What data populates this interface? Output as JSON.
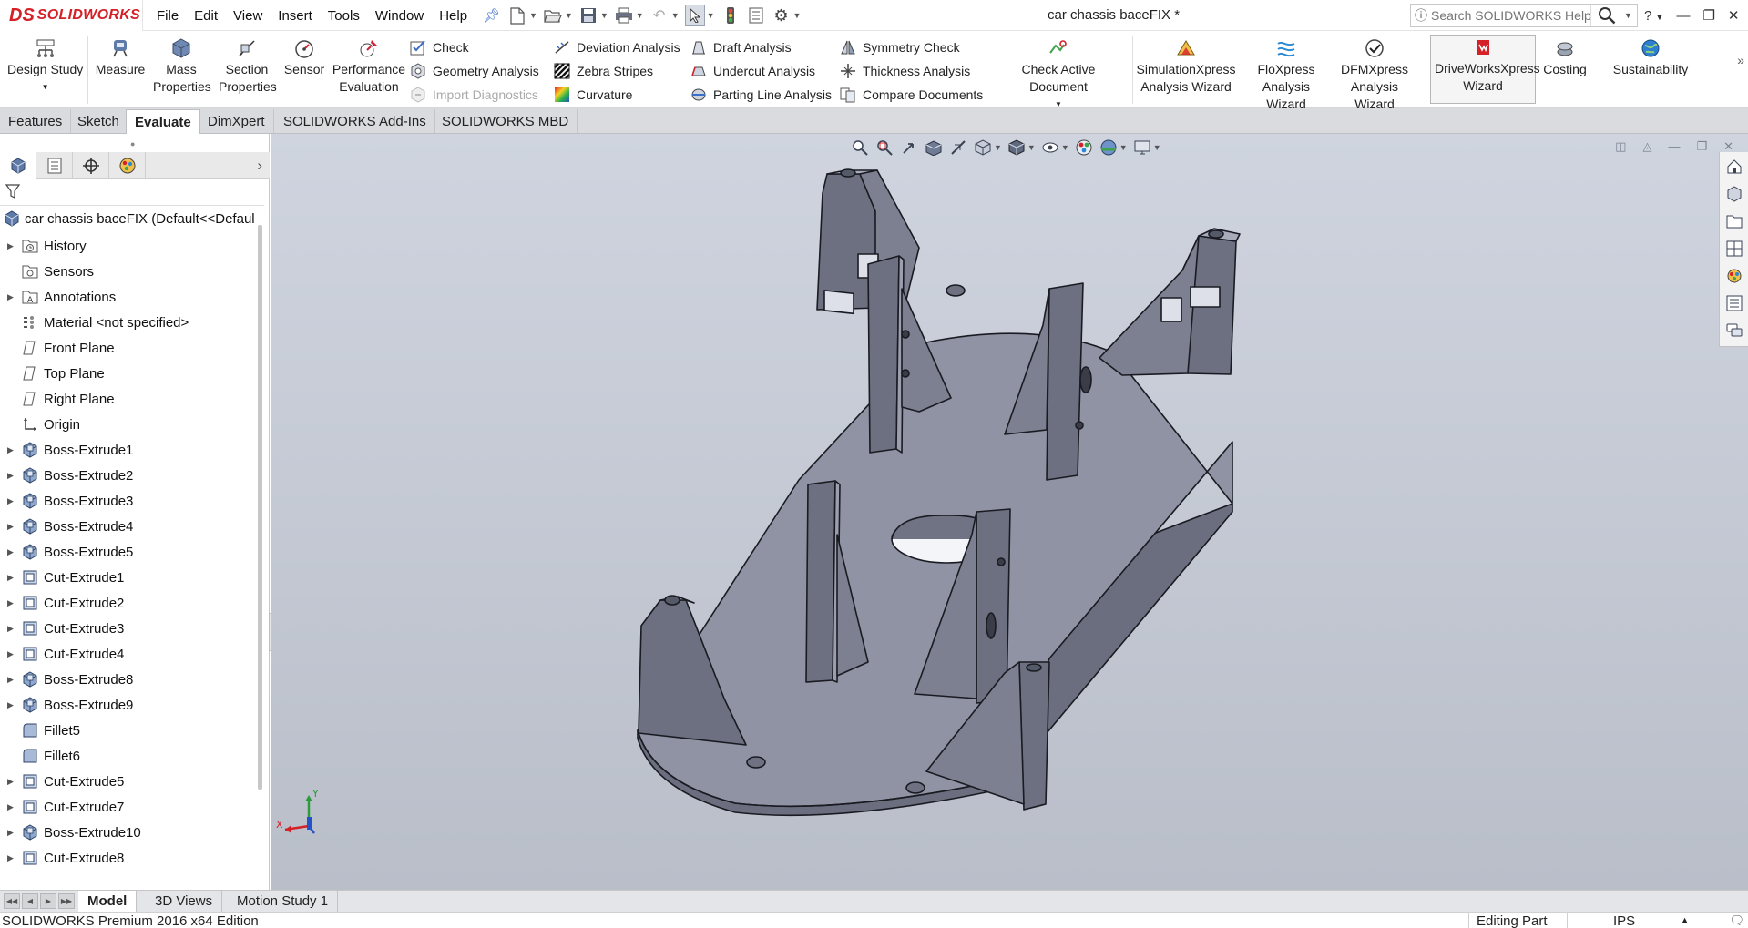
{
  "app": {
    "logo_ds": "DS",
    "logo_word": "SOLIDWORKS",
    "doc_title": "car chassis baceFIX *"
  },
  "menus": [
    "File",
    "Edit",
    "View",
    "Insert",
    "Tools",
    "Window",
    "Help"
  ],
  "help_search": {
    "placeholder": "Search SOLIDWORKS Help"
  },
  "ribbon": {
    "design_study": "Design Study",
    "measure": "Measure",
    "mass_properties": "Mass Properties",
    "section_properties": "Section Properties",
    "sensor": "Sensor",
    "performance_evaluation": "Performance Evaluation",
    "check": "Check",
    "geometry_analysis": "Geometry Analysis",
    "import_diagnostics": "Import Diagnostics",
    "deviation_analysis": "Deviation Analysis",
    "zebra_stripes": "Zebra Stripes",
    "curvature": "Curvature",
    "draft_analysis": "Draft Analysis",
    "undercut_analysis": "Undercut Analysis",
    "parting_line_analysis": "Parting Line Analysis",
    "symmetry_check": "Symmetry Check",
    "thickness_analysis": "Thickness Analysis",
    "compare_documents": "Compare Documents",
    "check_active_document": "Check Active Document",
    "simulationxpress": "SimulationXpress Analysis Wizard",
    "floxpress": "FloXpress Analysis Wizard",
    "dfmxpress": "DFMXpress Analysis Wizard",
    "driveworksxpress": "DriveWorksXpress Wizard",
    "costing": "Costing",
    "sustainability": "Sustainability"
  },
  "cm_tabs": [
    "Features",
    "Sketch",
    "Evaluate",
    "DimXpert",
    "SOLIDWORKS Add-Ins",
    "SOLIDWORKS MBD"
  ],
  "cm_active": "Evaluate",
  "tree": {
    "root": "car chassis baceFIX  (Default<<Defaul",
    "items": [
      {
        "label": "History",
        "icon": "history-folder-icon",
        "expandable": true
      },
      {
        "label": "Sensors",
        "icon": "sensors-icon",
        "expandable": false
      },
      {
        "label": "Annotations",
        "icon": "annotations-icon",
        "expandable": true
      },
      {
        "label": "Material <not specified>",
        "icon": "material-icon",
        "expandable": false
      },
      {
        "label": "Front Plane",
        "icon": "plane-icon",
        "expandable": false
      },
      {
        "label": "Top Plane",
        "icon": "plane-icon",
        "expandable": false
      },
      {
        "label": "Right Plane",
        "icon": "plane-icon",
        "expandable": false
      },
      {
        "label": "Origin",
        "icon": "origin-icon",
        "expandable": false
      },
      {
        "label": "Boss-Extrude1",
        "icon": "boss-extrude-icon",
        "expandable": true
      },
      {
        "label": "Boss-Extrude2",
        "icon": "boss-extrude-icon",
        "expandable": true
      },
      {
        "label": "Boss-Extrude3",
        "icon": "boss-extrude-icon",
        "expandable": true
      },
      {
        "label": "Boss-Extrude4",
        "icon": "boss-extrude-icon",
        "expandable": true
      },
      {
        "label": "Boss-Extrude5",
        "icon": "boss-extrude-icon",
        "expandable": true
      },
      {
        "label": "Cut-Extrude1",
        "icon": "cut-extrude-icon",
        "expandable": true
      },
      {
        "label": "Cut-Extrude2",
        "icon": "cut-extrude-icon",
        "expandable": true
      },
      {
        "label": "Cut-Extrude3",
        "icon": "cut-extrude-icon",
        "expandable": true
      },
      {
        "label": "Cut-Extrude4",
        "icon": "cut-extrude-icon",
        "expandable": true
      },
      {
        "label": "Boss-Extrude8",
        "icon": "boss-extrude-icon",
        "expandable": true
      },
      {
        "label": "Boss-Extrude9",
        "icon": "boss-extrude-icon",
        "expandable": true
      },
      {
        "label": "Fillet5",
        "icon": "fillet-icon",
        "expandable": false
      },
      {
        "label": "Fillet6",
        "icon": "fillet-icon",
        "expandable": false
      },
      {
        "label": "Cut-Extrude5",
        "icon": "cut-extrude-icon",
        "expandable": true
      },
      {
        "label": "Cut-Extrude7",
        "icon": "cut-extrude-icon",
        "expandable": true
      },
      {
        "label": "Boss-Extrude10",
        "icon": "boss-extrude-icon",
        "expandable": true
      },
      {
        "label": "Cut-Extrude8",
        "icon": "cut-extrude-icon",
        "expandable": true
      }
    ]
  },
  "triad": {
    "x": "X",
    "y": "Y"
  },
  "bottom_tabs": [
    "Model",
    "3D Views",
    "Motion Study 1"
  ],
  "bottom_active": "Model",
  "status": {
    "edition": "SOLIDWORKS Premium 2016 x64 Edition",
    "mode": "Editing Part",
    "units": "IPS"
  },
  "colors": {
    "brand_red": "#d42027",
    "viewport_bg": "#c6cbd6",
    "model_face": "#8f93a3"
  }
}
